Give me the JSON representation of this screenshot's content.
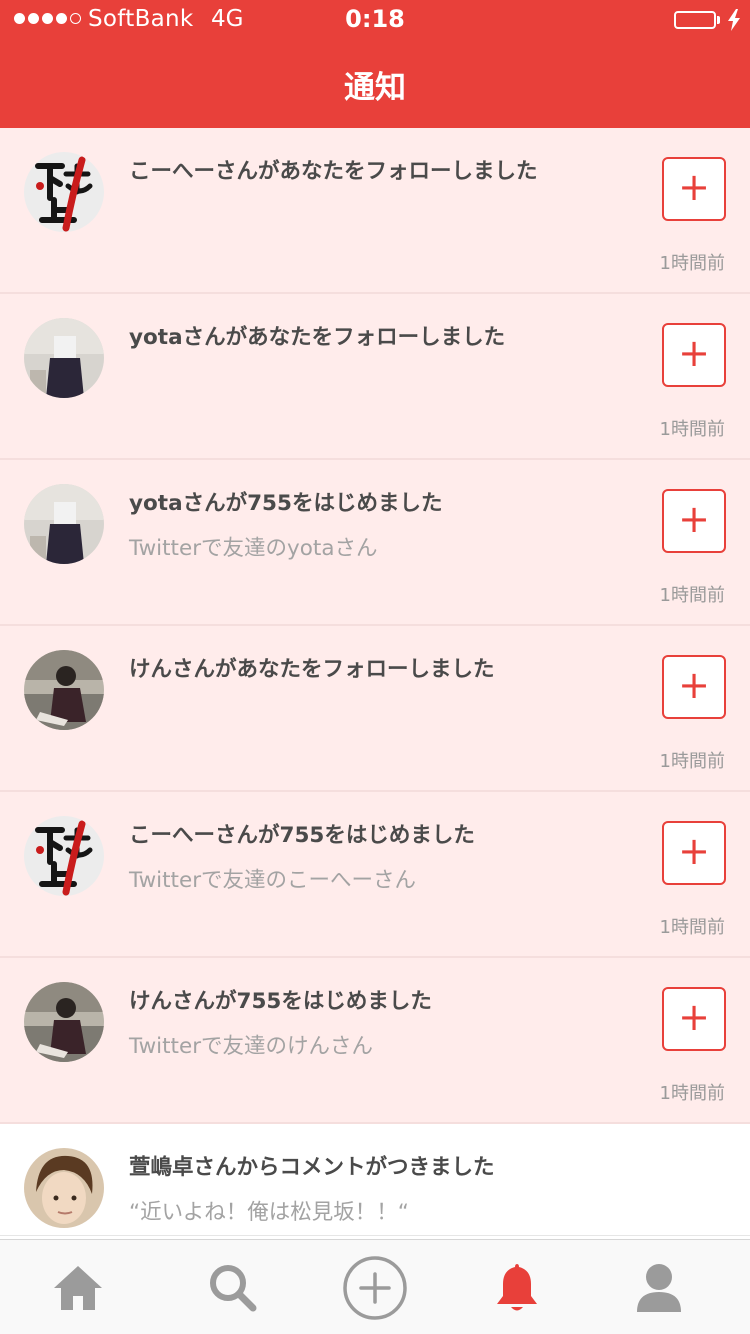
{
  "status_bar": {
    "carrier": "SoftBank",
    "network": "4G",
    "time": "0:18"
  },
  "nav": {
    "title": "通知"
  },
  "notifications": [
    {
      "message": "こーへーさんがあなたをフォローしました",
      "sub": "",
      "time": "1時間前",
      "action": "+",
      "avatar": "calligraphy-avatar"
    },
    {
      "message": "yotaさんがあなたをフォローしました",
      "sub": "",
      "time": "1時間前",
      "action": "+",
      "avatar": "photo-avatar"
    },
    {
      "message": "yotaさんが755をはじめました",
      "sub": "Twitterで友達のyotaさん",
      "time": "1時間前",
      "action": "+",
      "avatar": "photo-avatar"
    },
    {
      "message": "けんさんがあなたをフォローしました",
      "sub": "",
      "time": "1時間前",
      "action": "+",
      "avatar": "person-avatar"
    },
    {
      "message": "こーへーさんが755をはじめました",
      "sub": "Twitterで友達のこーへーさん",
      "time": "1時間前",
      "action": "+",
      "avatar": "calligraphy-avatar"
    },
    {
      "message": "けんさんが755をはじめました",
      "sub": "Twitterで友達のけんさん",
      "time": "1時間前",
      "action": "+",
      "avatar": "person-avatar"
    },
    {
      "message": "萱嶋卓さんからコメントがつきました",
      "sub": "“近いよね！俺は松見坂！！“",
      "avatar": "face-avatar"
    }
  ],
  "tabs": [
    {
      "name": "home-icon",
      "active": false
    },
    {
      "name": "search-icon",
      "active": false
    },
    {
      "name": "add-post-icon",
      "active": false
    },
    {
      "name": "notification-bell-icon",
      "active": true
    },
    {
      "name": "profile-icon",
      "active": false
    }
  ],
  "colors": {
    "accent": "#e8403a",
    "unread_bg": "#ffeceb",
    "text": "#4a4a4a",
    "muted": "#a3a3a3",
    "tab_inactive": "#9b9b9b"
  }
}
